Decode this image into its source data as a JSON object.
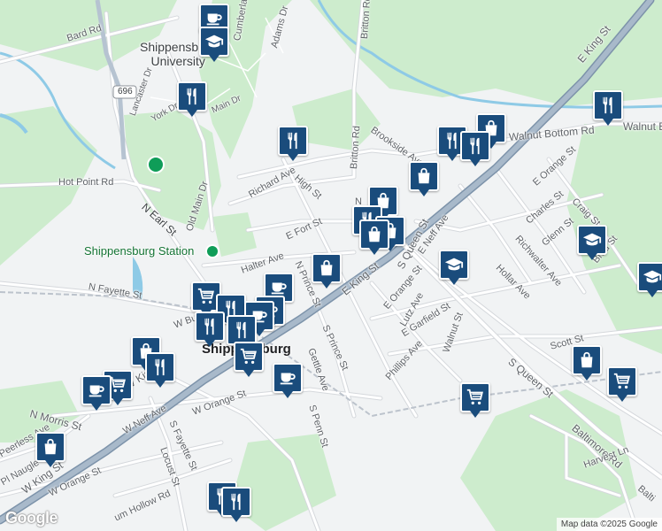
{
  "map": {
    "colors": {
      "background": "#f1f3f4",
      "green": "#cdeccd",
      "water": "#8ecae6",
      "road": "#ffffff",
      "road_outline": "#d5d8dc",
      "highway": "#8fa4b8",
      "rail": "#bcc3cc",
      "pin": "#1a4c7c"
    },
    "labels": {
      "shippensburg_university": "Shippensburg\nUniversity",
      "shippensburg_station": "Shippensburg Station",
      "shippensburg": "Shippensburg",
      "bard_rd": "Bard Rd",
      "hot_point_rd": "Hot Point Rd",
      "n_earl_st": "N Earl St",
      "old_main_dr": "Old Main Dr",
      "richard_ave": "Richard Ave",
      "high_st": "High St",
      "britton_rd_n": "Britton Rd",
      "britton_rd": "Britton Rd",
      "adams_dr": "Adams Dr",
      "cumberland_dr": "Cumberland Dr",
      "lancaster_dr": "Lancaster Dr",
      "york_dr": "York Dr",
      "main_dr": "Main Dr",
      "brookside_ave": "Brookside Ave",
      "walnut_bottom_rd": "Walnut Bottom Rd",
      "walnut_bottom_rd_2": "Walnut B",
      "e_king_st": "E King St",
      "e_king_st_2": "E King St",
      "e_orange_st": "E Orange St",
      "e_orange_st_2": "E Orange St",
      "charles_st": "Charles St",
      "craig_st": "Craig St",
      "richwalter_ave": "Richwalter Ave",
      "glenn_st": "Glenn St",
      "hollar_ave": "Hollar Ave",
      "brad_st": "Brad St",
      "e_neff_ave": "E Neff Ave",
      "s_queen_st": "S Queen St",
      "s_queen_st_2": "S Queen St",
      "lutz_ave": "Lutz Ave",
      "e_garfield_st": "E Garfield St",
      "walnut_st": "Walnut St",
      "phillips_ave": "Phillips Ave",
      "scott_st": "Scott St",
      "baltimore_rd": "Baltimore Rd",
      "harvest_ln": "Harvest Ln",
      "e_fort_st": "E Fort St",
      "halter_ave": "Halter Ave",
      "n_prince_st": "N Prince St",
      "s_prince_st": "S Prince St",
      "gettle_ave": "Gettle Ave",
      "s_penn_st": "S Penn St",
      "n_fayette_st": "N Fayette St",
      "w_king_st": "W King St",
      "w_king_st_2": "W King St",
      "w_burd": "W Bu",
      "n_morris_st": "N Morris St",
      "w_neff_ave": "W Neff Ave",
      "w_orange_st": "W Orange St",
      "w_orange_st_2": "W Orange St",
      "s_fayette_st": "S Fayette St",
      "locust_st": "Locust St",
      "peerless_ave": "Peerless Ave",
      "pl_naugle": "Pl Naugle",
      "cumm_hollow_rd": "um Hollow Rd",
      "route_696": "696",
      "baltimore_rd_2": "Balti",
      "n_queen_prefix": "N"
    },
    "attribution": "Map data ©2025 Google",
    "logo": "Google"
  }
}
